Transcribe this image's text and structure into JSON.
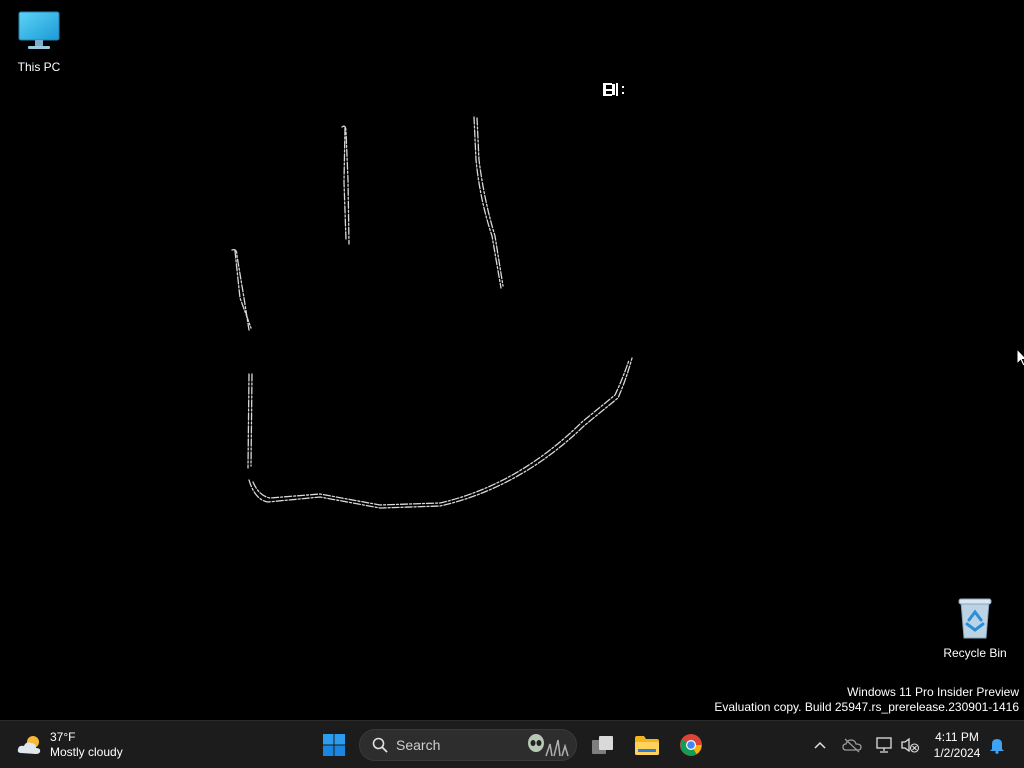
{
  "desktop": {
    "icons": [
      {
        "label": "This PC",
        "icon": "monitor-icon"
      },
      {
        "label": "Recycle Bin",
        "icon": "recycle-bin-icon"
      }
    ],
    "watermark": {
      "line1": "Windows 11 Pro Insider Preview",
      "line2": "Evaluation copy. Build 25947.rs_prerelease.230901-1416"
    }
  },
  "taskbar": {
    "weather": {
      "temp": "37°F",
      "condition": "Mostly cloudy",
      "icon": "cloudy-sun-icon"
    },
    "start": {
      "icon": "windows-logo-icon"
    },
    "search": {
      "placeholder": "Search",
      "icon": "search-icon"
    },
    "pinned": [
      {
        "name": "task-view",
        "icon": "task-view-icon"
      },
      {
        "name": "file-explorer",
        "icon": "folder-icon"
      },
      {
        "name": "chrome",
        "icon": "chrome-icon"
      }
    ],
    "tray": {
      "icons": [
        "chevron-up-icon",
        "onedrive-offline-icon",
        "network-icon",
        "speaker-muted-icon"
      ],
      "time": "4:11 PM",
      "date": "1/2/2024",
      "notification_icon": "bell-icon"
    }
  },
  "colors": {
    "desktop_bg": "#000000",
    "taskbar_bg": "#1c1c1c",
    "accent": "#0078d4"
  }
}
